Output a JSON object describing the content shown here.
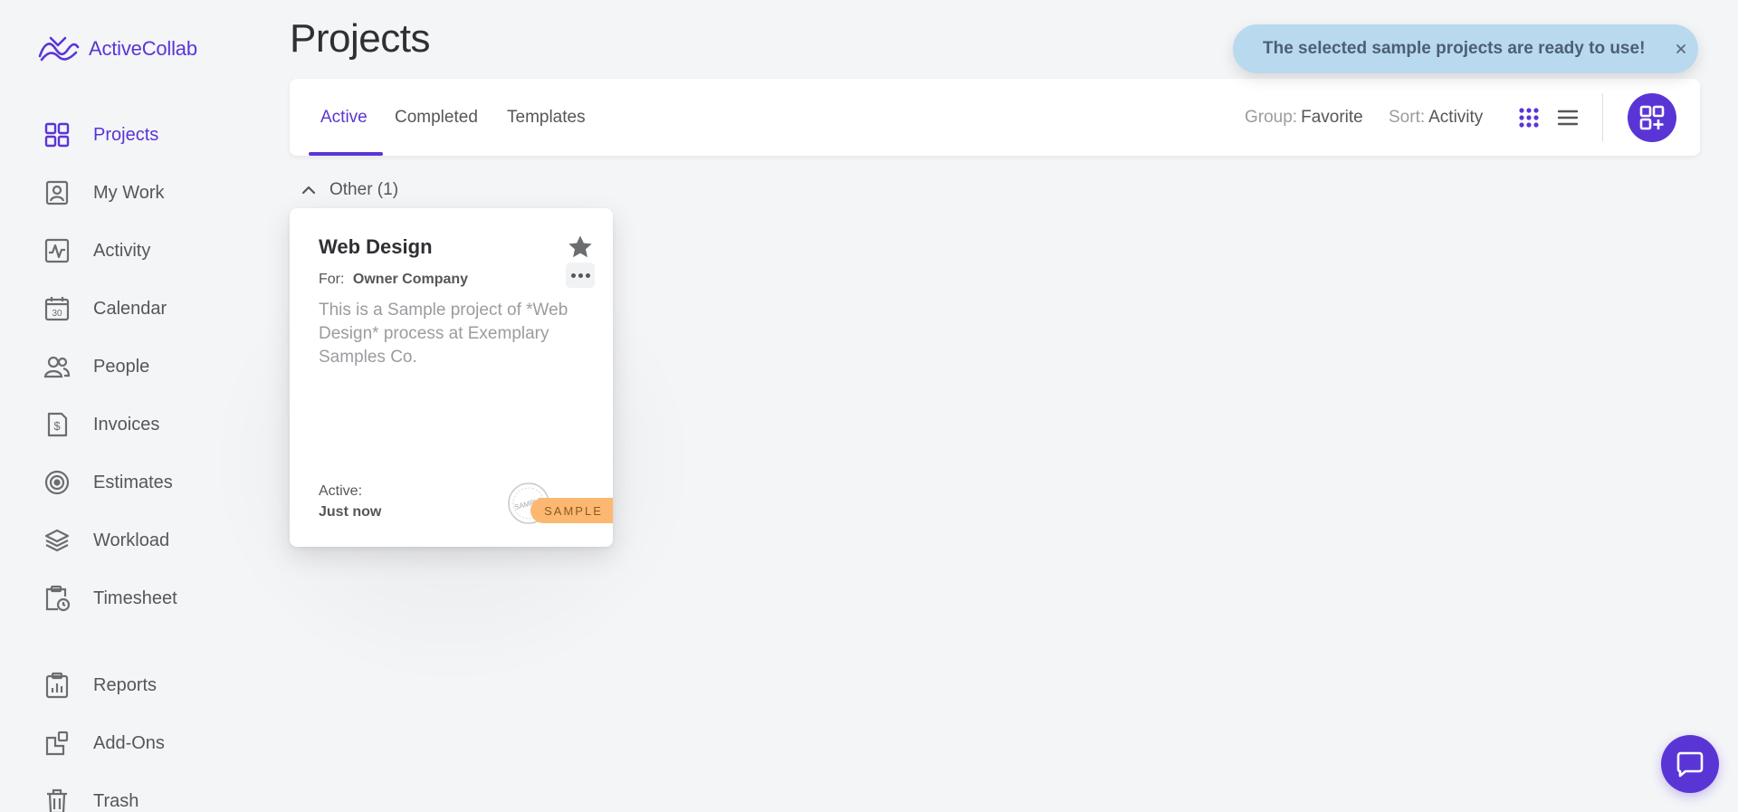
{
  "app": {
    "brand": "ActiveCollab",
    "accent_color": "#5a35d6"
  },
  "sidebar": {
    "items": [
      {
        "label": "Projects",
        "icon": "grid-icon",
        "active": true
      },
      {
        "label": "My Work",
        "icon": "my-work-icon"
      },
      {
        "label": "Activity",
        "icon": "activity-icon"
      },
      {
        "label": "Calendar",
        "icon": "calendar-icon",
        "icon_text": "30"
      },
      {
        "label": "People",
        "icon": "people-icon"
      },
      {
        "label": "Invoices",
        "icon": "invoice-icon",
        "icon_text": "$"
      },
      {
        "label": "Estimates",
        "icon": "target-icon"
      },
      {
        "label": "Workload",
        "icon": "layers-icon"
      },
      {
        "label": "Timesheet",
        "icon": "timesheet-icon"
      },
      {
        "label": "Reports",
        "icon": "reports-icon"
      },
      {
        "label": "Add-Ons",
        "icon": "add-ons-icon"
      },
      {
        "label": "Trash",
        "icon": "trash-icon"
      }
    ]
  },
  "page": {
    "title": "Projects"
  },
  "toolbar": {
    "tabs": [
      {
        "label": "Active",
        "active": true
      },
      {
        "label": "Completed"
      },
      {
        "label": "Templates"
      }
    ],
    "group_key": "Group:",
    "group_value": "Favorite",
    "sort_key": "Sort:",
    "sort_value": "Activity"
  },
  "group": {
    "label": "Other (1)"
  },
  "project_card": {
    "title": "Web Design",
    "for_key": "For:",
    "for_value": "Owner Company",
    "description": "This is a Sample project of *Web Design* process at Exemplary Samples Co.",
    "active_key": "Active:",
    "active_value": "Just now",
    "ribbon": "SAMPLE",
    "stamp_text": "SAMPLE"
  },
  "toast": {
    "message": "The selected sample projects are ready to use!",
    "close_glyph": "×",
    "color": "#b9d9ef"
  }
}
